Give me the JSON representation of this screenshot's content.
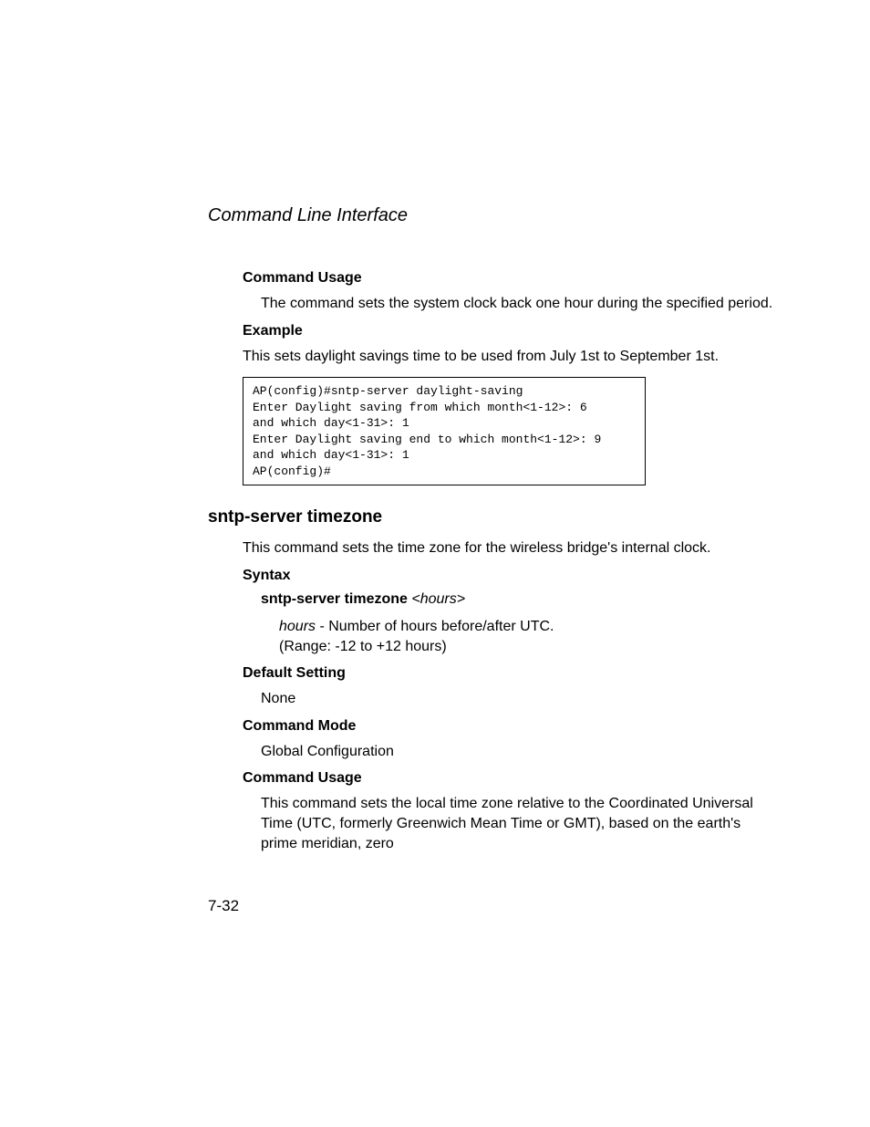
{
  "header": {
    "section_title": "Command Line Interface"
  },
  "section1": {
    "usage_heading": "Command Usage",
    "usage_text": "The command sets the system clock back one hour during the specified period.",
    "example_heading": "Example",
    "example_text": "This sets daylight savings time to be used from July 1st to September 1st.",
    "code_block": "AP(config)#sntp-server daylight-saving\nEnter Daylight saving from which month<1-12>: 6\nand which day<1-31>: 1\nEnter Daylight saving end to which month<1-12>: 9\nand which day<1-31>: 1\nAP(config)#"
  },
  "section2": {
    "command_title": "sntp-server timezone",
    "description": "This command sets the time zone for the wireless bridge's internal clock.",
    "syntax_heading": "Syntax",
    "syntax_cmd": "sntp-server timezone",
    "syntax_arg": "<hours>",
    "param_name": "hours",
    "param_desc_1": " - Number of hours before/after UTC.",
    "param_desc_2": "(Range: -12 to +12 hours)",
    "default_heading": "Default Setting",
    "default_text": "None",
    "mode_heading": "Command Mode",
    "mode_text": "Global Configuration",
    "usage_heading": "Command Usage",
    "usage_text": "This command sets the local time zone relative to the Coordinated Universal Time (UTC, formerly Greenwich Mean Time or GMT), based on the earth's prime meridian, zero"
  },
  "footer": {
    "page_number": "7-32"
  }
}
